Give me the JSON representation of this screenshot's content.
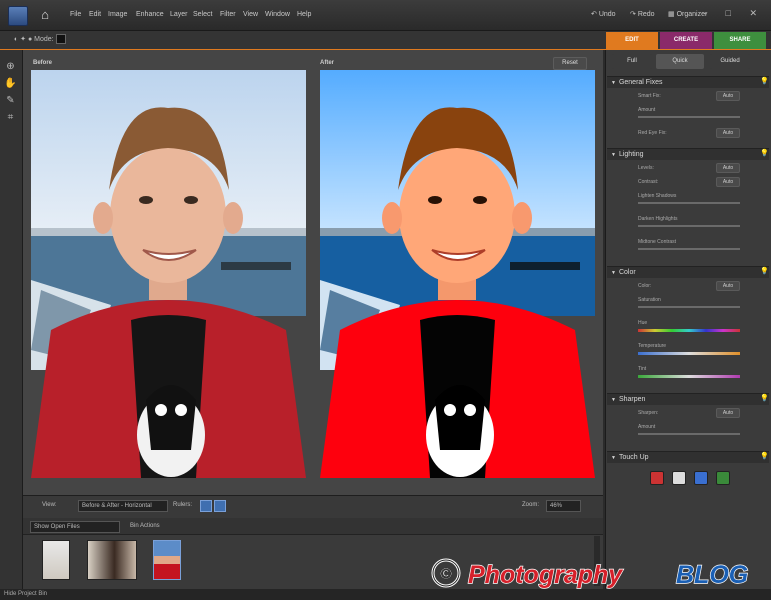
{
  "menu": {
    "items": [
      "File",
      "Edit",
      "Image",
      "Enhance",
      "Layer",
      "Select",
      "Filter",
      "View",
      "Window",
      "Help"
    ],
    "undo": "Undo",
    "redo": "Redo",
    "organizer": "Organizer",
    "window_controls": "– □ ✕"
  },
  "options_bar": {
    "label": "Mode:"
  },
  "modes": [
    {
      "label": "EDIT",
      "color": "#e07a1f"
    },
    {
      "label": "CREATE",
      "color": "#8a2a6a"
    },
    {
      "label": "SHARE",
      "color": "#3e8f3e"
    }
  ],
  "canvas": {
    "before_label": "Before",
    "after_label": "After",
    "reset_label": "Reset"
  },
  "view_bar": {
    "view_label": "View:",
    "view_value": "Before & After - Horizontal",
    "rulers_label": "Rulers:",
    "zoom_label": "Zoom:",
    "zoom_value": "46%"
  },
  "bin": {
    "show_label": "Show Open Files",
    "actions_label": "Bin Actions"
  },
  "status": {
    "text": "Hide Project Bin"
  },
  "panel": {
    "subtabs": [
      "Full",
      "Quick",
      "Guided"
    ],
    "sections": [
      {
        "title": "General Fixes",
        "rows": [
          {
            "label": "Smart Fix:",
            "auto": "Auto"
          },
          {
            "label": "Amount",
            "slider": true
          },
          {
            "label": "Red Eye Fix:",
            "auto": "Auto"
          }
        ]
      },
      {
        "title": "Lighting",
        "rows": [
          {
            "label": "Levels:",
            "auto": "Auto"
          },
          {
            "label": "Contrast:",
            "auto": "Auto"
          },
          {
            "label": "Lighten Shadows",
            "slider": true
          },
          {
            "label": "Darken Highlights",
            "slider": true
          },
          {
            "label": "Midtone Contrast",
            "slider": true
          }
        ]
      },
      {
        "title": "Color",
        "rows": [
          {
            "label": "Color:",
            "auto": "Auto"
          },
          {
            "label": "Saturation",
            "slider": true
          },
          {
            "label": "Hue",
            "color": true
          },
          {
            "label": "Temperature",
            "color": true
          },
          {
            "label": "Tint",
            "color": true
          }
        ]
      },
      {
        "title": "Sharpen",
        "rows": [
          {
            "label": "Sharpen:",
            "auto": "Auto"
          },
          {
            "label": "Amount",
            "slider": true
          }
        ]
      },
      {
        "title": "Touch Up",
        "rows": []
      }
    ]
  },
  "watermark": {
    "symbol": "©",
    "word1": "Photography",
    "word2": "BLOG"
  }
}
